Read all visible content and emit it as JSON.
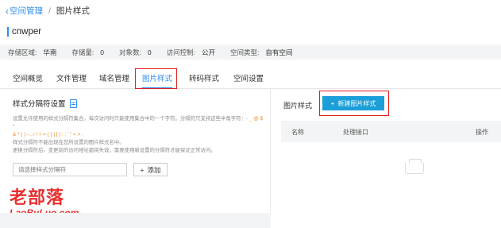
{
  "breadcrumb": {
    "back": "空间管理",
    "separator": "/",
    "current": "图片样式"
  },
  "bucket": {
    "name": "cnwper"
  },
  "info": {
    "region_label": "存储区域:",
    "region_value": "华南",
    "storage_label": "存储量:",
    "storage_value": "0",
    "objects_label": "对象数:",
    "objects_value": "0",
    "access_label": "访问控制:",
    "access_value": "公开",
    "type_label": "空间类型:",
    "type_value": "自有空间"
  },
  "tabs": [
    {
      "label": "空间概览"
    },
    {
      "label": "文件管理"
    },
    {
      "label": "域名管理"
    },
    {
      "label": "图片样式",
      "active": true
    },
    {
      "label": "转码样式"
    },
    {
      "label": "空间设置"
    }
  ],
  "separator_settings": {
    "title": "样式分隔符设置",
    "desc_line1_a": "设置允许使用的样式分隔符集合，每次访问时只能使用集合中的一个字符。分隔符只支持这些半角字符：",
    "desc_line1_chars": "- _ @ $ *",
    "desc_line2_chars": "& * ( ) - , / ! + = { } | [ ] : ; ' \" < > ,",
    "desc_line2_b": "",
    "desc_line3": "样式分隔符不能出现在您所设置的图片样式名中。",
    "desc_line4": "更换分隔符后，变更前的访问地址都将失效，需要使用新设置的分隔符才能保证正常访问。",
    "input_placeholder": "请选择样式分隔符",
    "add_label": "添加",
    "add_icon": "+"
  },
  "image_styles": {
    "title": "图片样式",
    "new_label": "新建图片样式",
    "new_icon": "+",
    "columns": [
      "名称",
      "处理接口",
      "操作"
    ]
  },
  "watermark": {
    "cn": "老部落",
    "en": "LaoBuLuo.com"
  },
  "colors": {
    "accent": "#2d8cf0",
    "primary_button": "#1b9fd9",
    "highlight": "#e02020"
  }
}
